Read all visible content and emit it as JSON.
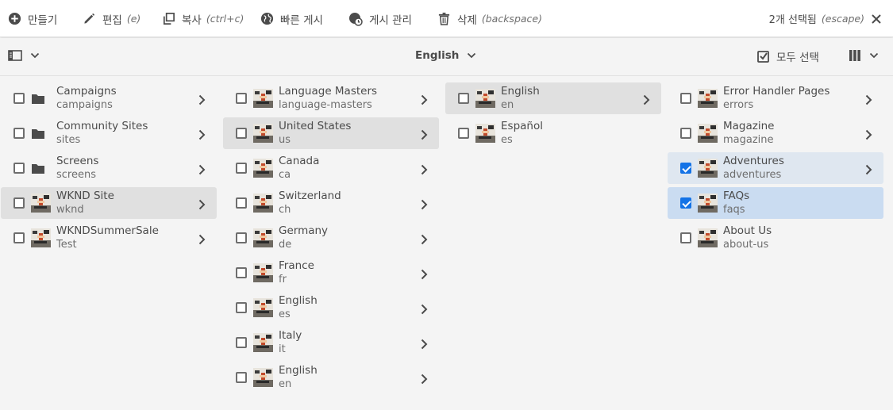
{
  "actionbar": {
    "create_label": "만들기",
    "edit_label": "편집",
    "edit_hint": "(e)",
    "copy_label": "복사",
    "copy_hint": "(ctrl+c)",
    "quick_publish_label": "빠른 게시",
    "manage_publication_label": "게시 관리",
    "delete_label": "삭제",
    "delete_hint": "(backspace)",
    "selection_count": "2개 선택됨",
    "selection_hint": "(escape)"
  },
  "titlebar": {
    "title": "English",
    "select_all_label": "모두 선택"
  },
  "columns": [
    {
      "items": [
        {
          "title": "Campaigns",
          "name": "campaigns",
          "thumb": "folder-icon",
          "state": "normal",
          "has_children": true
        },
        {
          "title": "Community Sites",
          "name": "sites",
          "thumb": "folder-icon",
          "state": "normal",
          "has_children": true
        },
        {
          "title": "Screens",
          "name": "screens",
          "thumb": "folder-icon",
          "state": "normal",
          "has_children": true
        },
        {
          "title": "WKND Site",
          "name": "wknd",
          "thumb": "page-thumbnail",
          "state": "active",
          "has_children": true
        },
        {
          "title": "WKNDSummerSale",
          "name": "Test",
          "thumb": "page-thumbnail",
          "state": "normal",
          "has_children": true
        }
      ]
    },
    {
      "items": [
        {
          "title": "Language Masters",
          "name": "language-masters",
          "thumb": "page-thumbnail",
          "state": "normal",
          "has_children": true
        },
        {
          "title": "United States",
          "name": "us",
          "thumb": "page-thumbnail",
          "state": "active",
          "has_children": true
        },
        {
          "title": "Canada",
          "name": "ca",
          "thumb": "page-thumbnail",
          "state": "normal",
          "has_children": true
        },
        {
          "title": "Switzerland",
          "name": "ch",
          "thumb": "page-thumbnail",
          "state": "normal",
          "has_children": true
        },
        {
          "title": "Germany",
          "name": "de",
          "thumb": "page-thumbnail",
          "state": "normal",
          "has_children": true
        },
        {
          "title": "France",
          "name": "fr",
          "thumb": "page-thumbnail",
          "state": "normal",
          "has_children": true
        },
        {
          "title": "English",
          "name": "es",
          "thumb": "page-thumbnail",
          "state": "normal",
          "has_children": true
        },
        {
          "title": "Italy",
          "name": "it",
          "thumb": "page-thumbnail",
          "state": "normal",
          "has_children": true
        },
        {
          "title": "English",
          "name": "en",
          "thumb": "page-thumbnail",
          "state": "normal",
          "has_children": true
        }
      ]
    },
    {
      "items": [
        {
          "title": "English",
          "name": "en",
          "thumb": "page-thumbnail",
          "state": "active",
          "has_children": true
        },
        {
          "title": "Español",
          "name": "es",
          "thumb": "page-thumbnail",
          "state": "normal",
          "has_children": false
        }
      ]
    },
    {
      "items": [
        {
          "title": "Error Handler Pages",
          "name": "errors",
          "thumb": "page-thumbnail",
          "state": "normal",
          "has_children": true
        },
        {
          "title": "Magazine",
          "name": "magazine",
          "thumb": "page-thumbnail",
          "state": "normal",
          "has_children": true
        },
        {
          "title": "Adventures",
          "name": "adventures",
          "thumb": "page-thumbnail",
          "state": "checked-light",
          "checked": true,
          "has_children": true
        },
        {
          "title": "FAQs",
          "name": "faqs",
          "thumb": "page-thumbnail",
          "state": "checked-strong",
          "checked": true,
          "has_children": false
        },
        {
          "title": "About Us",
          "name": "about-us",
          "thumb": "page-thumbnail",
          "state": "normal",
          "has_children": false
        }
      ]
    }
  ],
  "colors": {
    "accent": "#1473e6",
    "active_row": "#e0e0e0",
    "selected_row": "#cadcf1",
    "selected_row_light": "#dfe7f0",
    "text": "#4b4b4b",
    "subtext": "#6e6e6e"
  }
}
